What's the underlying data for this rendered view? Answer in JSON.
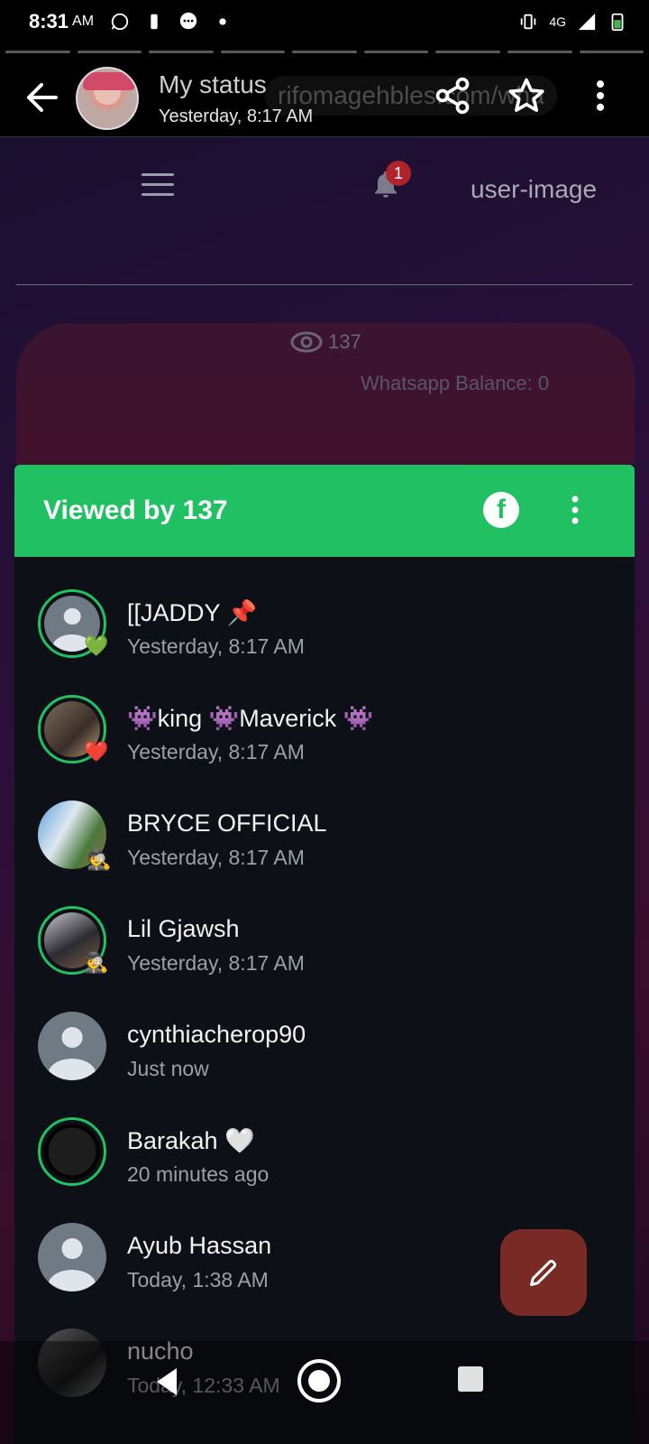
{
  "status_bar": {
    "time": "8:31",
    "ampm": "AM",
    "network": "4G",
    "icons": [
      "whatsapp-icon",
      "battery-saver-icon",
      "message-icon",
      "dot-icon",
      "vibrate-icon",
      "signal-icon",
      "battery-icon"
    ]
  },
  "status_header": {
    "title": "My status",
    "subtitle": "Yesterday, 8:17 AM",
    "url_ghost": "rifomagehbles.com/wha",
    "icons": [
      "back-arrow-icon",
      "share-icon",
      "star-icon",
      "more-vert-icon"
    ]
  },
  "background_site": {
    "user_label": "user-image",
    "notification_count": "1",
    "views": "137",
    "balance": "Whatsapp Balance: 0"
  },
  "sheet": {
    "title": "Viewed by 137",
    "accent": "#21c063",
    "viewers": [
      {
        "name": "[[JADDY 📌",
        "time": "Yesterday, 8:17 AM",
        "reaction": "💚"
      },
      {
        "name": "👾king 👾Maverick 👾",
        "time": "Yesterday, 8:17 AM",
        "reaction": "❤️"
      },
      {
        "name": "BRYCE OFFICIAL",
        "time": "Yesterday, 8:17 AM",
        "reaction": "🕵️"
      },
      {
        "name": "Lil Gjawsh",
        "time": "Yesterday, 8:17 AM",
        "reaction": "🕵️"
      },
      {
        "name": "cynthiacherop90",
        "time": "Just now",
        "reaction": ""
      },
      {
        "name": "Barakah 🤍",
        "time": "20 minutes ago",
        "reaction": ""
      },
      {
        "name": "Ayub Hassan",
        "time": "Today, 1:38 AM",
        "reaction": ""
      },
      {
        "name": "nucho",
        "time": "Today, 12:33 AM",
        "reaction": ""
      }
    ]
  },
  "fab": {
    "icon": "pencil-icon",
    "color": "#7a2a24"
  },
  "nav_bar": {
    "icons": [
      "nav-back-icon",
      "nav-home-icon",
      "nav-recents-icon"
    ]
  }
}
